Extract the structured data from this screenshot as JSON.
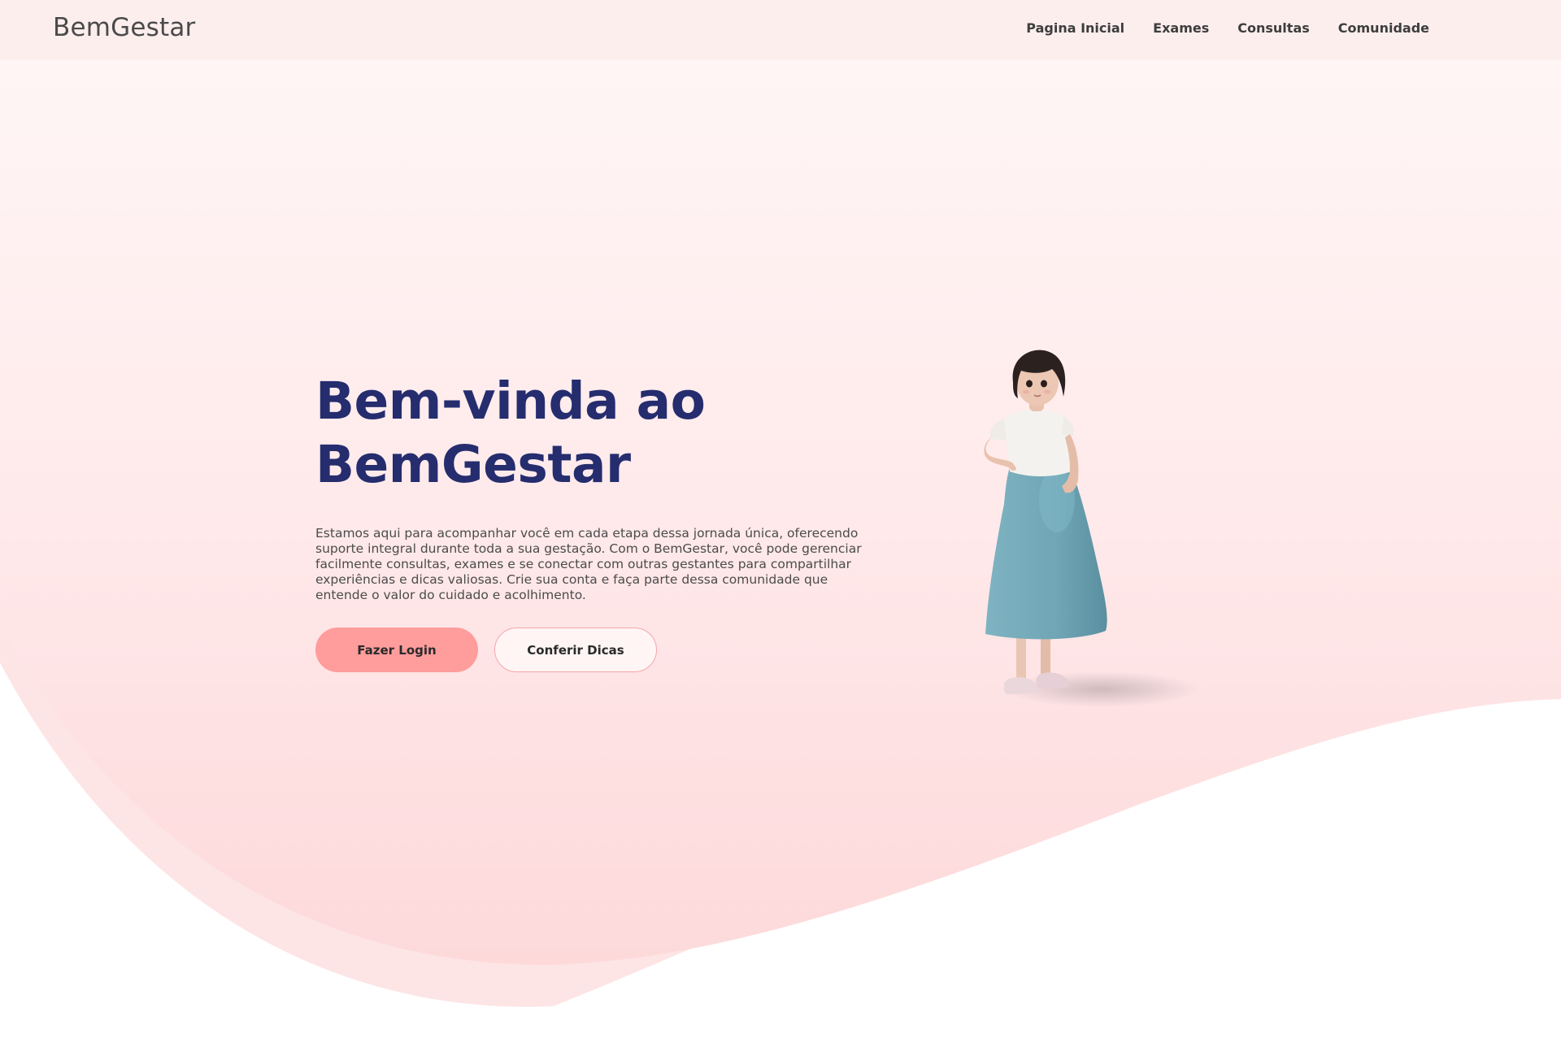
{
  "nav": {
    "brand": "BemGestar",
    "links": [
      "Pagina Inicial",
      "Exames",
      "Consultas",
      "Comunidade"
    ]
  },
  "hero": {
    "title_line1": "Bem-vinda ao",
    "title_line2": "BemGestar",
    "description": "Estamos aqui para acompanhar você em cada etapa dessa jornada única, oferecendo suporte integral durante toda a sua gestação. Com o BemGestar, você pode gerenciar facilmente consultas, exames e se conectar com outras gestantes para compartilhar experiências e dicas valiosas. Crie sua conta e faça parte dessa comunidade que entende o valor do cuidado e acolhimento.",
    "primary_button": "Fazer Login",
    "secondary_button": "Conferir Dicas"
  },
  "colors": {
    "title": "#252d6e",
    "primary_button": "#ff9c9c",
    "navbar_bg": "#fdeeee",
    "wave_pink": "#fddcdd"
  },
  "illustration": "pregnant-woman-figure"
}
